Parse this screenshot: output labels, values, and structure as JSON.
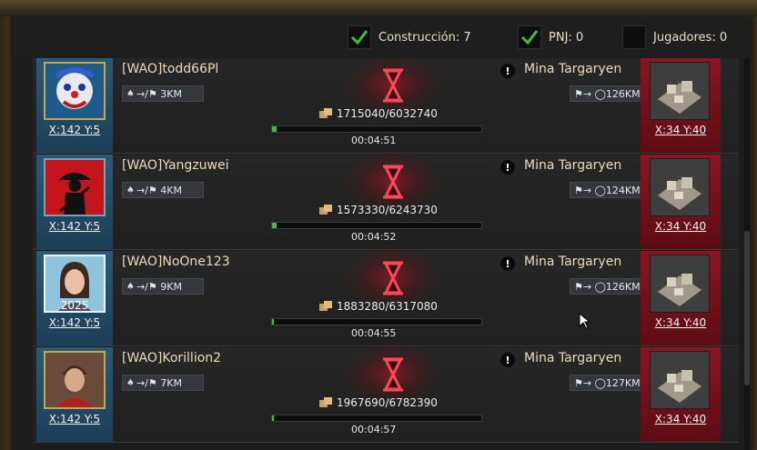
{
  "filters": [
    {
      "label": "Construcción: 7",
      "checked": true
    },
    {
      "label": "PNJ: 0",
      "checked": true
    },
    {
      "label": "Jugadores: 0",
      "checked": false
    }
  ],
  "rows": [
    {
      "player": "[WAO]todd66Pl",
      "coord": "X:142 Y:5",
      "distance": "→/⚑ 3KM",
      "resources": "1715040/6032740",
      "progress": 0.02,
      "timer": "00:04:51",
      "target": "Mina Targaryen",
      "target_distance": "⚑→ ◯126KM",
      "target_coord": "X:34 Y:40",
      "avatar": "clown-avatar"
    },
    {
      "player": "[WAO]Yangzuwei",
      "coord": "X:142 Y:5",
      "distance": "→/⚑ 4KM",
      "resources": "1573330/6243730",
      "progress": 0.02,
      "timer": "00:04:52",
      "target": "Mina Targaryen",
      "target_distance": "⚑→ ◯124KM",
      "target_coord": "X:34 Y:40",
      "avatar": "samurai-avatar"
    },
    {
      "player": "[WAO]NoOne123",
      "coord": "X:142 Y:5",
      "distance": "→/⚑ 9KM",
      "resources": "1883280/6317080",
      "progress": 0.01,
      "timer": "00:04:55",
      "target": "Mina Targaryen",
      "target_distance": "⚑→ ◯126KM",
      "target_coord": "X:34 Y:40",
      "avatar": "girl-avatar"
    },
    {
      "player": "[WAO]Korillion2",
      "coord": "X:142 Y:5",
      "distance": "→/⚑ 7KM",
      "resources": "1967690/6782390",
      "progress": 0.01,
      "timer": "00:04:57",
      "target": "Mina Targaryen",
      "target_distance": "⚑→ ◯127KM",
      "target_coord": "X:34 Y:40",
      "avatar": "warrior-avatar"
    }
  ],
  "colors": {
    "accent_green": "#3fbf3f",
    "alert_red": "#d11a2a",
    "name_text": "#ecdcb7"
  }
}
